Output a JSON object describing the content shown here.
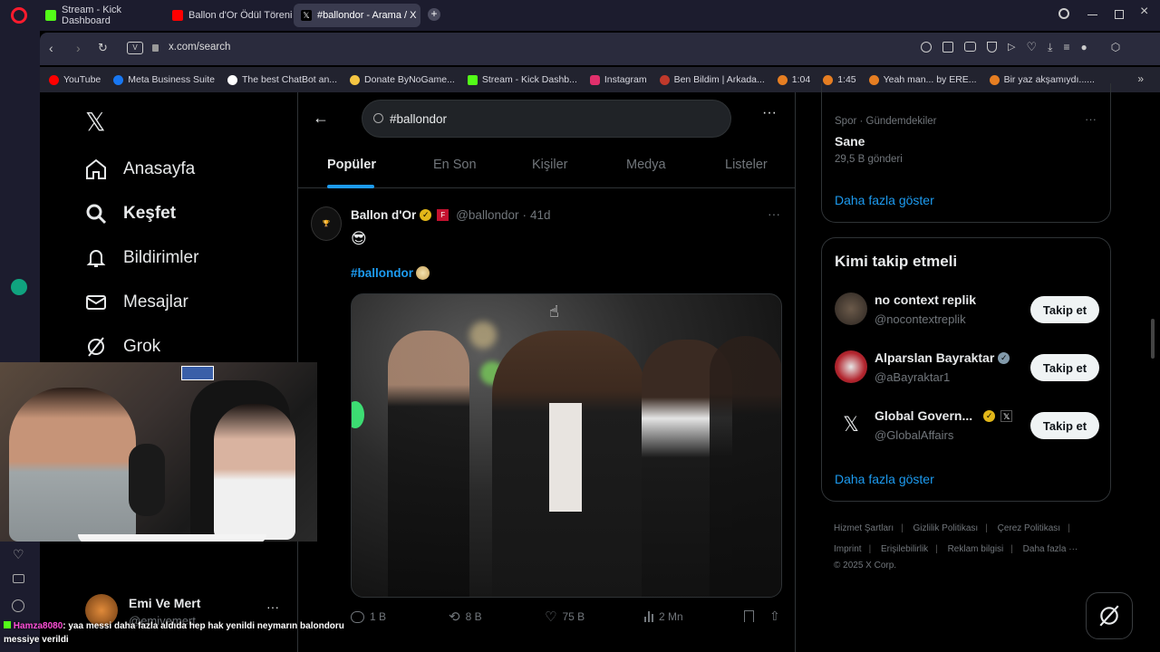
{
  "browser": {
    "tabs": [
      {
        "label": "Stream - Kick Dashboard",
        "icon": "kick-icon",
        "color": "#53fc18"
      },
      {
        "label": "Ballon d'Or Ödül Töreni",
        "icon": "youtube-icon",
        "color": "#ff0000"
      },
      {
        "label": "#ballondor - Arama / X",
        "icon": "x-icon",
        "color": "#000000"
      }
    ],
    "url": "x.com/search",
    "bookmarks": [
      {
        "label": "YouTube",
        "color": "#ff0000"
      },
      {
        "label": "Meta Business Suite",
        "color": "#1877f2"
      },
      {
        "label": "The best ChatBot an...",
        "color": "#ffffff"
      },
      {
        "label": "Donate ByNoGame...",
        "color": "#f5c542"
      },
      {
        "label": "Stream - Kick Dashb...",
        "color": "#53fc18"
      },
      {
        "label": "Instagram",
        "color": "#e1306c"
      },
      {
        "label": "Ben Bildim | Arkada...",
        "color": "#c0392b"
      },
      {
        "label": "1:04",
        "color": "#e67e22"
      },
      {
        "label": "1:45",
        "color": "#e67e22"
      },
      {
        "label": "Yeah man... by ERE...",
        "color": "#e67e22"
      },
      {
        "label": "Bir yaz akşamıydı......",
        "color": "#e67e22"
      }
    ]
  },
  "nav": {
    "items": [
      {
        "label": "Anasayfa",
        "icon": "home-icon"
      },
      {
        "label": "Keşfet",
        "icon": "search-icon"
      },
      {
        "label": "Bildirimler",
        "icon": "bell-icon"
      },
      {
        "label": "Mesajlar",
        "icon": "mail-icon"
      },
      {
        "label": "Grok",
        "icon": "grok-icon"
      }
    ],
    "profile_name": "Emi Ve Mert",
    "profile_handle": "@emivemert"
  },
  "search": {
    "value": "#ballondor",
    "tabs": [
      "Popüler",
      "En Son",
      "Kişiler",
      "Medya",
      "Listeler"
    ]
  },
  "tweet": {
    "author": "Ballon d'Or",
    "handle": "@ballondor",
    "time": "41d",
    "emoji": "😎",
    "hashtag": "#ballondor",
    "stats": {
      "replies": "1 B",
      "reposts": "8 B",
      "likes": "75 B",
      "views": "2 Mn"
    }
  },
  "trend": {
    "category": "Spor · Gündemdekiler",
    "name": "Sane",
    "count": "29,5 B gönderi",
    "more": "Daha fazla göster"
  },
  "who_to_follow": {
    "title": "Kimi takip etmeli",
    "users": [
      {
        "name": "no context replik",
        "handle": "@nocontextreplik",
        "button": "Takip et"
      },
      {
        "name": "Alparslan Bayraktar",
        "handle": "@aBayraktar1",
        "button": "Takip et"
      },
      {
        "name": "Global Govern...",
        "handle": "@GlobalAffairs",
        "button": "Takip et"
      }
    ],
    "more": "Daha fazla göster"
  },
  "footer": {
    "links": [
      "Hizmet Şartları",
      "Gizlilik Politikası",
      "Çerez Politikası",
      "Imprint",
      "Erişilebilirlik",
      "Reklam bilgisi",
      "Daha fazla ···"
    ],
    "copyright": "© 2025 X Corp."
  },
  "chat": {
    "user": "Hamza8080",
    "message": ": yaa messi daha fazla aldıda hep hak yenildi neymarın balondoru messiye verildi"
  },
  "colors": {
    "accent": "#1d9bf0",
    "verified_gold": "#e2b719"
  }
}
